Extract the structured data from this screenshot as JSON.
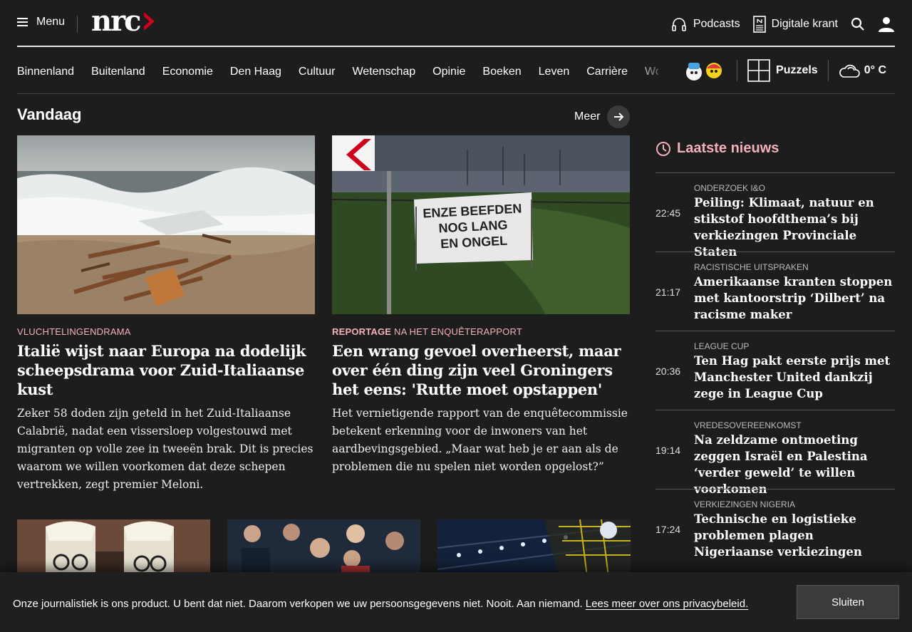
{
  "header": {
    "menu_label": "Menu",
    "logo_text": "nrc",
    "podcasts_label": "Podcasts",
    "krant_label": "Digitale krant"
  },
  "nav": {
    "items": [
      "Binnenland",
      "Buitenland",
      "Economie",
      "Den Haag",
      "Cultuur",
      "Wetenschap",
      "Opinie",
      "Boeken",
      "Leven",
      "Carrière",
      "Wonen"
    ],
    "puzzels_label": "Puzzels",
    "temperature": "0° C"
  },
  "vandaag": {
    "title": "Vandaag",
    "meer_label": "Meer"
  },
  "articles": [
    {
      "kicker_strong": "",
      "kicker": "VLUCHTELINGENDRAMA",
      "title": "Italië wijst naar Europa na dodelijk scheepsdrama voor Zuid-Italiaanse kust",
      "summary": "Zeker 58 doden zijn geteld in het Zuid-Italiaanse Calabrië, nadat een vissersloep volgestouwd met migranten op volle zee in tweeën brak. Dit is precies waarom we willen voorkomen dat deze schepen vertrekken, zegt premier Meloni."
    },
    {
      "kicker_strong": "REPORTAGE",
      "kicker": "NA HET ENQUÊTERAPPORT",
      "title": "Een wrang gevoel overheerst, maar over één ding zijn veel Groningers het eens: 'Rutte moet opstappen'",
      "summary": "Het vernietigende rapport van de enquêtecommissie betekent erkenning voor de inwoners van het aardbevingsgebied. „Maar wat heb je er aan als de problemen die nu spelen niet worden opgelost?”",
      "banner_text": [
        "ENZE BEEFDEN",
        "NOG LANG",
        "EN ONGEL"
      ]
    }
  ],
  "latest_news": {
    "title": "Laatste nieuws",
    "items": [
      {
        "time": "22:45",
        "category": "ONDERZOEK I&O",
        "title": "Peiling: Klimaat, natuur en stikstof hoofdthema’s bij verkiezingen Provinciale Staten"
      },
      {
        "time": "21:17",
        "category": "RACISTISCHE UITSPRAKEN",
        "title": "Amerikaanse kranten stoppen met kantoorstrip ‘Dilbert’ na racisme maker"
      },
      {
        "time": "20:36",
        "category": "LEAGUE CUP",
        "title": "Ten Hag pakt eerste prijs met Manchester United dankzij zege in League Cup"
      },
      {
        "time": "19:14",
        "category": "VREDESOVEREENKOMST",
        "title": "Na zeldzame ontmoeting zeggen Israël en Palestina ‘verder geweld’ te willen voorkomen"
      },
      {
        "time": "17:24",
        "category": "VERKIEZINGEN NIGERIA",
        "title": "Technische en logistieke problemen plagen Nigeriaanse verkiezingen"
      }
    ]
  },
  "cookie": {
    "text": "Onze journalistiek is ons product. U bent dat niet. Daarom verkopen we uw persoonsgegevens niet. Nooit. Aan niemand.",
    "link": "Lees meer over ons privacybeleid.",
    "button": "Sluiten"
  },
  "colors": {
    "background": "#1d1d1d",
    "accent_pink": "#f3b1b9",
    "logo_red": "#d0021b"
  }
}
